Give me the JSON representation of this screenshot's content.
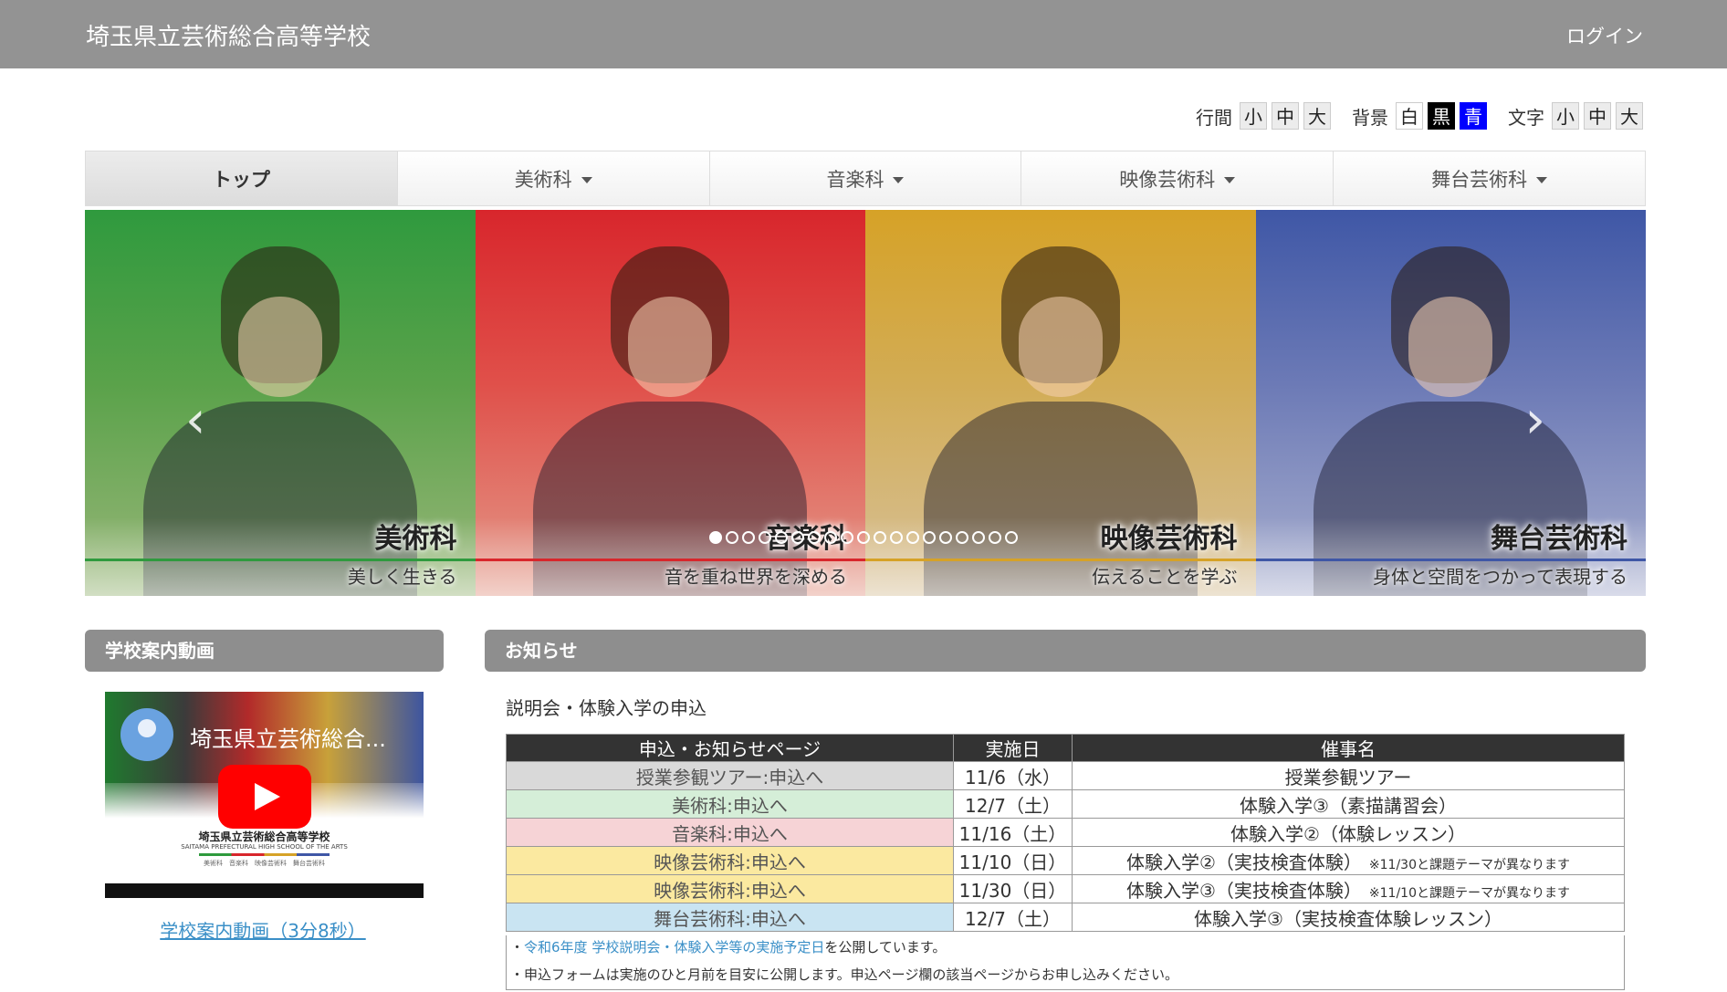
{
  "header": {
    "site_title": "埼玉県立芸術総合高等学校",
    "login": "ログイン"
  },
  "a11y": {
    "line_spacing": {
      "label": "行間",
      "options": [
        "小",
        "中",
        "大"
      ]
    },
    "background": {
      "label": "背景",
      "options": [
        "白",
        "黒",
        "青"
      ]
    },
    "text_size": {
      "label": "文字",
      "options": [
        "小",
        "中",
        "大"
      ]
    }
  },
  "nav": {
    "items": [
      {
        "label": "トップ",
        "active": true,
        "dropdown": false
      },
      {
        "label": "美術科",
        "active": false,
        "dropdown": true
      },
      {
        "label": "音楽科",
        "active": false,
        "dropdown": true
      },
      {
        "label": "映像芸術科",
        "active": false,
        "dropdown": true
      },
      {
        "label": "舞台芸術科",
        "active": false,
        "dropdown": true
      }
    ]
  },
  "carousel": {
    "panels": [
      {
        "title": "美術科",
        "subtitle": "美しく生きる",
        "color": "#2f9a3e"
      },
      {
        "title": "音楽科",
        "subtitle": "音を重ね世界を深める",
        "color": "#d8262c"
      },
      {
        "title": "映像芸術科",
        "subtitle": "伝えることを学ぶ",
        "color": "#d6a227"
      },
      {
        "title": "舞台芸術科",
        "subtitle": "身体と空間をつかって表現する",
        "color": "#3f57a6"
      }
    ],
    "indicator_count": 19,
    "active_index": 0,
    "prev_icon": "chevron-left-icon",
    "next_icon": "chevron-right-icon"
  },
  "video_section": {
    "heading": "学校案内動画",
    "video_title": "埼玉県立芸術総合...",
    "thumb_school": "埼玉県立芸術総合高等学校",
    "thumb_school_en": "SAITAMA PREFECTURAL HIGH SCHOOL OF THE ARTS",
    "thumb_depts": "美術科　音楽科　映像芸術科　舞台芸術科",
    "link": "学校案内動画（3分8秒）"
  },
  "news": {
    "heading": "お知らせ",
    "subheading": "説明会・体験入学の申込",
    "table": {
      "headers": [
        "申込・お知らせページ",
        "実施日",
        "催事名"
      ],
      "rows": [
        {
          "page": "授業参観ツアー:申込へ",
          "date": "11/6（水）",
          "event": "授業参観ツアー",
          "note": "",
          "bg": "#d9d9d9"
        },
        {
          "page": "美術科:申込へ",
          "date": "12/7（土）",
          "event": "体験入学③（素描講習会）",
          "note": "",
          "bg": "#d5eed8"
        },
        {
          "page": "音楽科:申込へ",
          "date": "11/16（土）",
          "event": "体験入学②（体験レッスン）",
          "note": "",
          "bg": "#f6d3d6"
        },
        {
          "page": "映像芸術科:申込へ",
          "date": "11/10（日）",
          "event": "体験入学②（実技検査体験）",
          "note": "※11/30と課題テーマが異なります",
          "bg": "#fbe9a0"
        },
        {
          "page": "映像芸術科:申込へ",
          "date": "11/30（日）",
          "event": "体験入学③（実技検査体験）",
          "note": "※11/10と課題テーマが異なります",
          "bg": "#fbe9a0"
        },
        {
          "page": "舞台芸術科:申込へ",
          "date": "12/7（土）",
          "event": "体験入学③（実技検査体験レッスン）",
          "note": "",
          "bg": "#c9e4f2"
        }
      ]
    },
    "notes": [
      {
        "prefix": "・",
        "link": "令和6年度 学校説明会・体験入学等の実施予定日",
        "text": "を公開しています。"
      },
      {
        "prefix": "・",
        "link": "",
        "text": "申込フォームは実施のひと月前を目安に公開します。申込ページ欄の該当ページからお申し込みください。"
      }
    ]
  }
}
